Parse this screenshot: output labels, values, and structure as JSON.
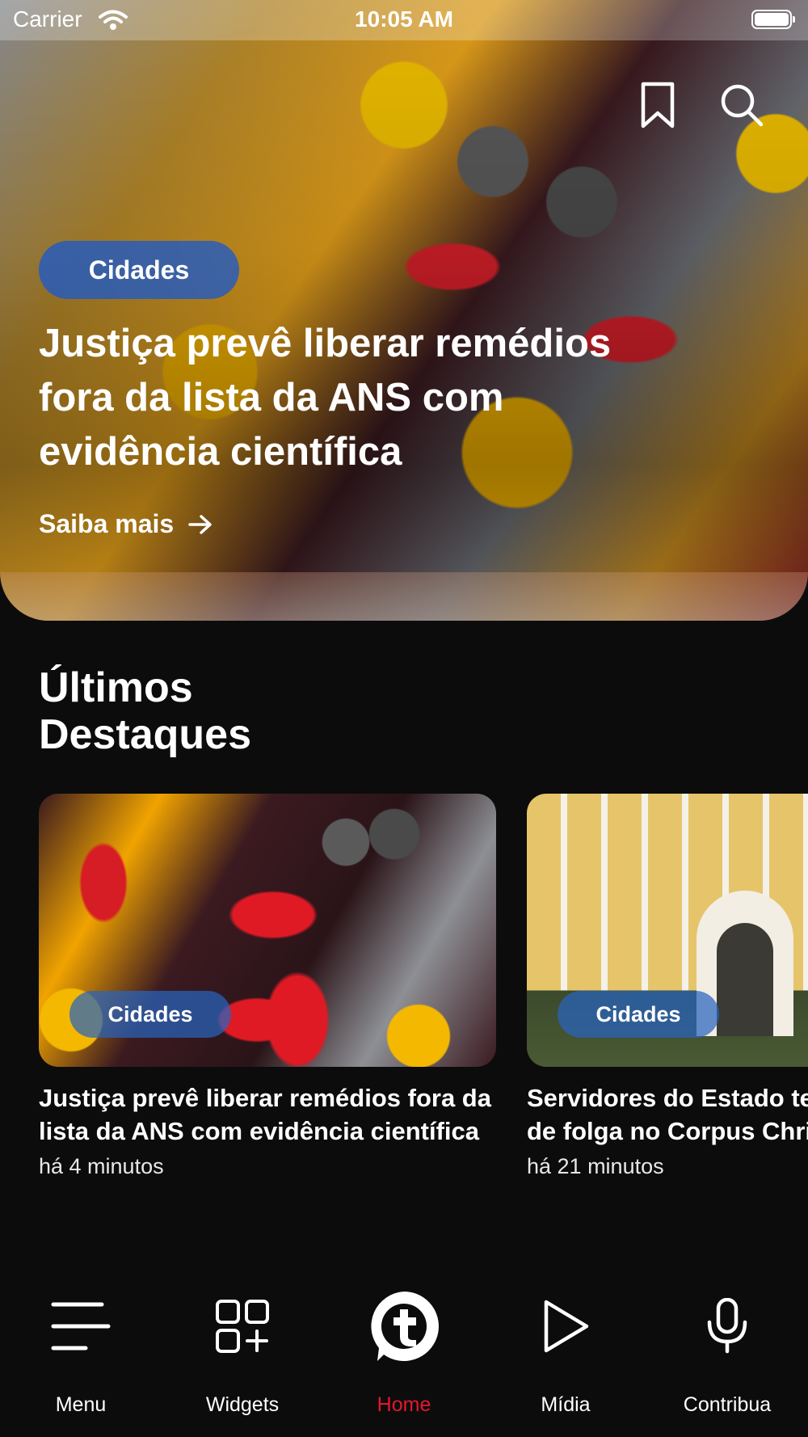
{
  "status_bar": {
    "carrier": "Carrier",
    "time": "10:05 AM"
  },
  "hero": {
    "category": "Cidades",
    "title": "Justiça prevê liberar remédios fora da lista da ANS com evidência científica",
    "link_label": "Saiba mais",
    "icons": [
      "bookmark-icon",
      "search-icon",
      "arrow-right-icon"
    ]
  },
  "section": {
    "title_line1": "Últimos",
    "title_line2": "Destaques"
  },
  "cards": [
    {
      "category": "Cidades",
      "title": "Justiça prevê liberar remédios fora da lista da ANS com evidência científica",
      "time": "há 4 minutos"
    },
    {
      "category": "Cidades",
      "title": "Servidores do Estado terão quatro dias de folga no Corpus Christi",
      "time": "há 21 minutos"
    }
  ],
  "tabbar": {
    "tabs": [
      {
        "label": "Menu",
        "icon": "menu-icon"
      },
      {
        "label": "Widgets",
        "icon": "widgets-icon"
      },
      {
        "label": "Home",
        "icon": "logo-t-icon"
      },
      {
        "label": "Mídia",
        "icon": "play-icon"
      },
      {
        "label": "Contribua",
        "icon": "microphone-icon"
      }
    ],
    "active": "Home",
    "active_color": "#e5172b"
  },
  "colors": {
    "background": "#0c0c0d",
    "badge": "#1e5ac8",
    "text": "#ffffff"
  }
}
